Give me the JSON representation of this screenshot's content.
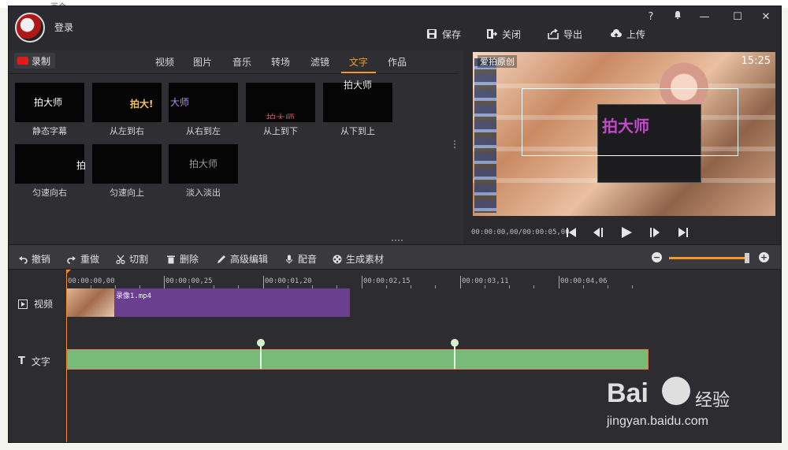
{
  "background": {
    "peek_text": "画个"
  },
  "app": {
    "login_label": "登录",
    "window_controls": {
      "help": "?",
      "min": "—",
      "max": "☐",
      "close": "✕"
    },
    "top_actions": [
      {
        "label": "保存",
        "icon": "save-icon"
      },
      {
        "label": "关闭",
        "icon": "exit-icon"
      },
      {
        "label": "导出",
        "icon": "export-icon"
      },
      {
        "label": "上传",
        "icon": "cloud-upload-icon"
      }
    ],
    "record_label": "录制",
    "tabs": [
      "视频",
      "图片",
      "音乐",
      "转场",
      "滤镜",
      "文字",
      "作品"
    ],
    "active_tab": "文字",
    "effects": [
      {
        "label": "静态字幕",
        "preview": "拍大师"
      },
      {
        "label": "从左到右",
        "preview": "拍大!"
      },
      {
        "label": "从右到左",
        "preview": "大师"
      },
      {
        "label": "从上到下",
        "preview": "拍大师"
      },
      {
        "label": "从下到上",
        "preview": "拍大师"
      },
      {
        "label": "匀速向右",
        "preview": "拍"
      },
      {
        "label": "匀速向上",
        "preview": ""
      },
      {
        "label": "淡入淡出",
        "preview": "拍大师"
      }
    ],
    "preview": {
      "brand_text": "爱拍原创",
      "clock_text": "15:25",
      "watermark_text": "拍大师",
      "timecode": "00:00:00,00/00:00:05,00"
    },
    "toolbar": [
      {
        "label": "撤销",
        "icon": "undo-icon"
      },
      {
        "label": "重做",
        "icon": "redo-icon"
      },
      {
        "label": "切割",
        "icon": "scissors-icon"
      },
      {
        "label": "删除",
        "icon": "trash-icon"
      },
      {
        "label": "高级编辑",
        "icon": "pencil-icon"
      },
      {
        "label": "配音",
        "icon": "microphone-icon"
      },
      {
        "label": "生成素材",
        "icon": "film-reel-icon"
      }
    ],
    "zoom": {
      "minus": "−",
      "plus": "+",
      "level": 1.0
    },
    "timeline": {
      "ruler_labels": [
        "00:00:00,00",
        "00:00:00,25",
        "00:00:01,20",
        "00:00:02,15",
        "00:00:03,11",
        "00:00:04,06"
      ],
      "tracks": [
        {
          "label": "视频",
          "icon": "video-play-icon"
        },
        {
          "label": "文字",
          "icon": "text-t-icon"
        }
      ],
      "video_clip_name": "录像1.mp4"
    }
  },
  "watermark": {
    "brand": "Bai",
    "brand2": "经验",
    "url": "jingyan.baidu.com"
  }
}
